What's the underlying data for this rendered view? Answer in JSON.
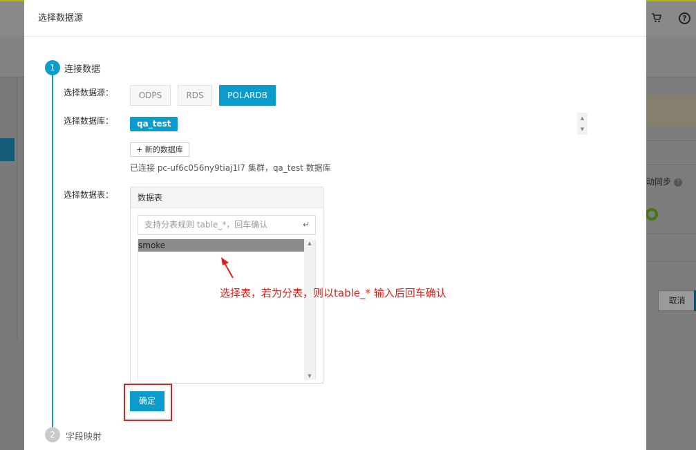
{
  "background": {
    "auto_sync_label": "动同步",
    "cancel_label": "取消",
    "help_icon": "question-circle-icon",
    "cart_icon": "cart-icon"
  },
  "modal": {
    "title": "选择数据源",
    "step1": {
      "number": "1",
      "title": "连接数据"
    },
    "step2": {
      "number": "2",
      "title": "字段映射"
    },
    "source": {
      "label": "选择数据源：",
      "options": [
        "ODPS",
        "RDS",
        "POLARDB"
      ],
      "selected": "POLARDB"
    },
    "database": {
      "label": "选择数据库：",
      "selected_tag": "qa_test",
      "new_button": "+ 新的数据库",
      "connected_text": "已连接 pc-uf6c056ny9tiaj1l7 集群，qa_test 数据库"
    },
    "table": {
      "label": "选择数据表：",
      "panel_title": "数据表",
      "search_placeholder": "支持分表规则 table_*，回车确认",
      "enter_icon": "↵",
      "items": [
        "smoke"
      ],
      "selected": "smoke"
    },
    "confirm_label": "确定"
  },
  "annotation": {
    "text": "选择表，若为分表，则以table_* 输入后回车确认",
    "color": "#e0201b"
  },
  "colors": {
    "accent": "#0c9ccc",
    "annotation": "#e0201b"
  }
}
